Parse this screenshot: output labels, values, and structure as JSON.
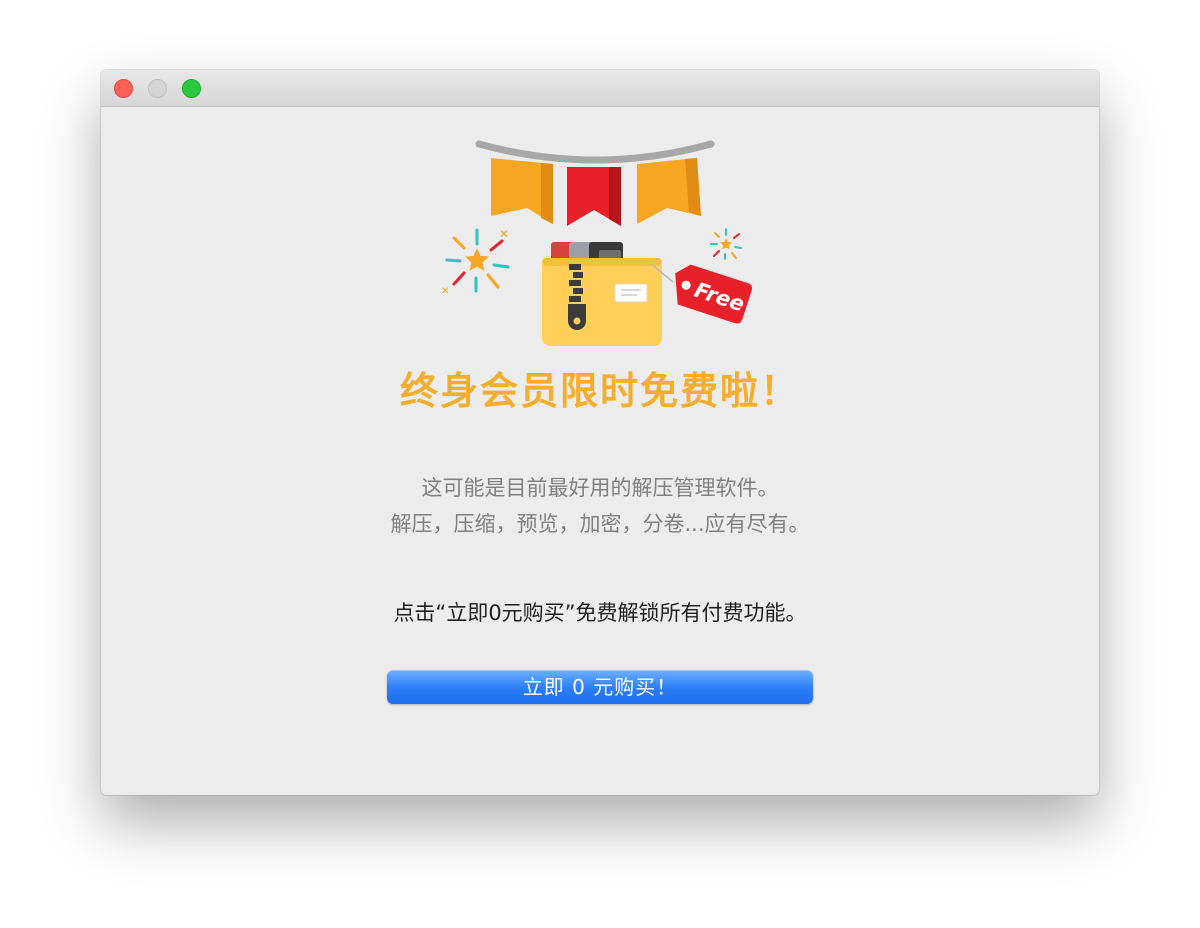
{
  "window": {
    "controls": [
      "close",
      "minimize",
      "zoom"
    ]
  },
  "illustration": {
    "tag_label": "Free",
    "icons": [
      "bunting-flags-icon",
      "firework-left-icon",
      "firework-right-icon",
      "zip-folder-icon",
      "free-tag-icon"
    ]
  },
  "content": {
    "headline": "终身会员限时免费啦！",
    "description_line1": "这可能是目前最好用的解压管理软件。",
    "description_line2": "解压，压缩，预览，加密，分卷...应有尽有。",
    "cta_text": "点击“立即0元购买”免费解锁所有付费功能。",
    "buy_button_label": "立即 0 元购买！"
  },
  "colors": {
    "headline": "#f4ad2c",
    "button": "#2b7cf6",
    "tag": "#e8202a"
  }
}
